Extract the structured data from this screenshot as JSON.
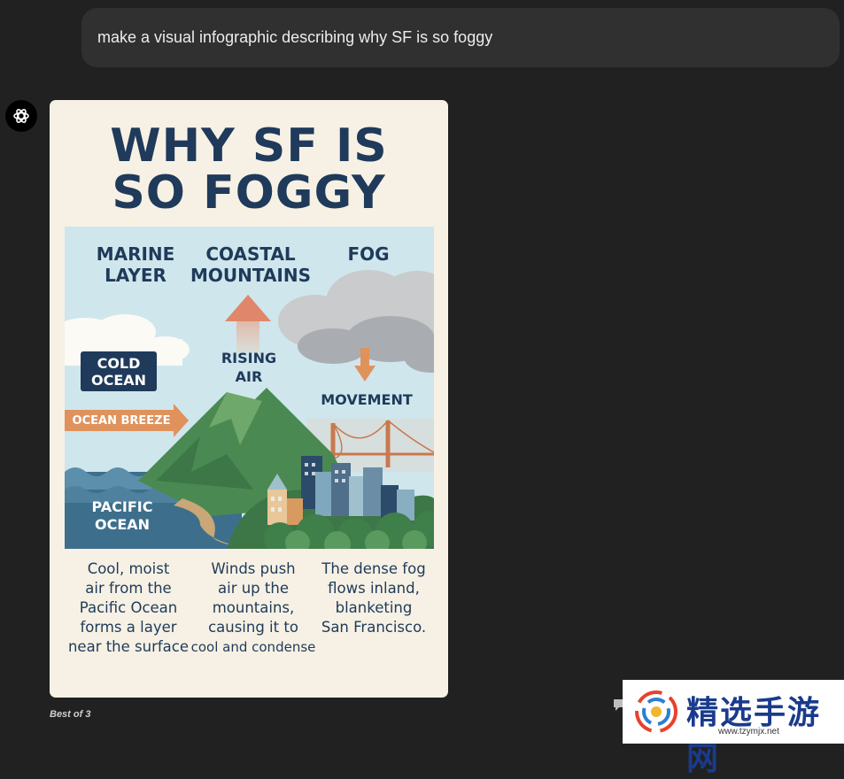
{
  "chat": {
    "user_message": "make a visual infographic describing why SF is so foggy",
    "footer": "Best of 3"
  },
  "infographic": {
    "title_line1": "WHY SF IS",
    "title_line2": "SO FOGGY",
    "headers": {
      "marine_line1": "MARINE",
      "marine_line2": "LAYER",
      "coastal_line1": "COASTAL",
      "coastal_line2": "MOUNTAINS",
      "fog": "FOG"
    },
    "labels": {
      "cold_line1": "COLD",
      "cold_line2": "OCEAN",
      "rising_line1": "RISING",
      "rising_line2": "AIR",
      "movement": "MOVEMENT",
      "breeze": "OCEAN BREEZE",
      "pacific_line1": "PACIFIC",
      "pacific_line2": "OCEAN"
    },
    "descriptions": {
      "col1": [
        "Cool, moist",
        "air from the",
        "Pacific Ocean",
        "forms a layer",
        "near the surface"
      ],
      "col2": [
        "Winds push",
        "air up the",
        "mountains,",
        "causing it to",
        "cool and condense"
      ],
      "col3": [
        "The dense fog",
        "flows inland,",
        "blanketing",
        "San Francisco."
      ]
    },
    "colors": {
      "navy": "#1f3a5a",
      "sky": "#cfe6ec",
      "orange": "#e0925c",
      "green": "#4a8a52",
      "ocean": "#3d6f8c",
      "cream": "#f6f1e4"
    }
  },
  "watermark": {
    "text": "精选手游网",
    "url": "www.tzymjx.net"
  },
  "icons": [
    "chatgpt-logo-icon",
    "comment-icon"
  ]
}
